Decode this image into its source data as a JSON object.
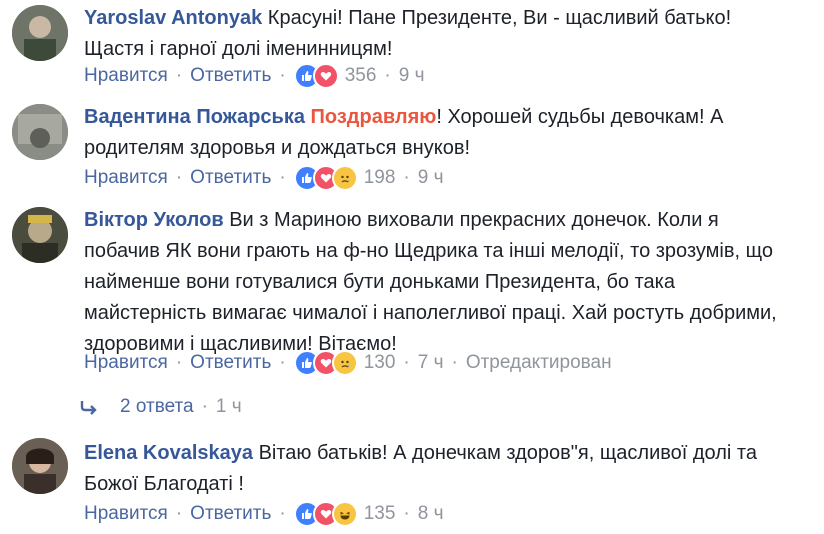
{
  "comments": [
    {
      "author": "Yaroslav Antonyak",
      "text_lines": [
        "Красуні! Пане Президенте, Ви - щасливий батько!",
        "Щастя і гарної долі іменинницям!"
      ],
      "like_label": "Нравится",
      "reply_label": "Ответить",
      "reactions": [
        "like-icon",
        "love-icon"
      ],
      "count": "356",
      "time": "9 ч"
    },
    {
      "author": "Вадентина Пожарська",
      "highlight": "Поздравляю",
      "text_lines": [
        "! Хорошей судьбы девочкам! А",
        "родителям здоровья и дождаться внуков!"
      ],
      "like_label": "Нравится",
      "reply_label": "Ответить",
      "reactions": [
        "like-icon",
        "love-icon",
        "sad-icon"
      ],
      "count": "198",
      "time": "9 ч"
    },
    {
      "author": "Віктор Уколов",
      "text_lines": [
        "Ви з Мариною виховали прекрасних донечок. Коли я",
        "побачив ЯК вони грають на ф-но Щедрика та інші мелодії, то зрозумів, що",
        "найменше вони готувалися бути доньками Президента, бо така",
        "майстерність вимагає чималої і наполегливої праці. Хай ростуть добрими,",
        "здоровими і щасливими! Вітаємо!"
      ],
      "like_label": "Нравится",
      "reply_label": "Ответить",
      "reactions": [
        "like-icon",
        "love-icon",
        "sad-icon"
      ],
      "count": "130",
      "time": "7 ч",
      "edited": "Отредактирован"
    },
    {
      "author": "Elena Kovalskaya",
      "text_lines": [
        "Вітаю батьків! А донечкам здоров\"я, щасливої долі та",
        "Божої Благодаті !"
      ],
      "like_label": "Нравится",
      "reply_label": "Ответить",
      "reactions": [
        "like-icon",
        "love-icon",
        "haha-icon"
      ],
      "count": "135",
      "time": "8 ч"
    }
  ],
  "replies": {
    "label": "2 ответа",
    "time": "1 ч"
  },
  "colors": {
    "author": "#365899",
    "action_link": "#4b67a1",
    "meta": "#90949c",
    "highlight": "#e9573f"
  }
}
